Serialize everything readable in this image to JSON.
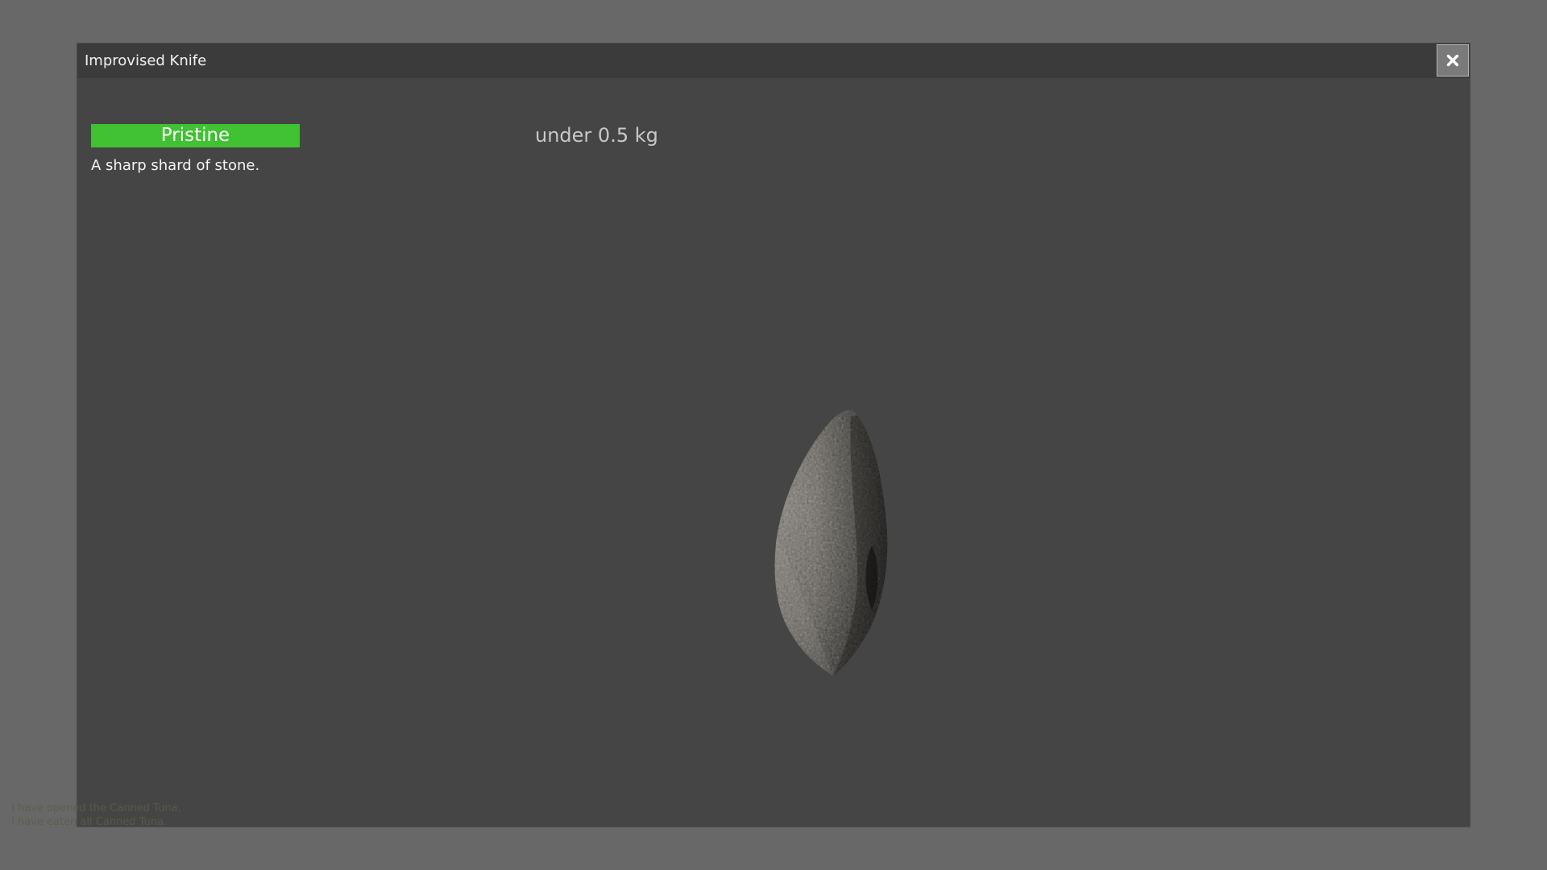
{
  "item_window": {
    "title": "Improvised Knife",
    "condition": "Pristine",
    "condition_color": "#40c232",
    "weight": "under 0.5 kg",
    "description": "A sharp shard of stone.",
    "close_icon": "close-icon"
  },
  "message_log": [
    "I have opened the Canned Tuna.",
    "I have eaten all Canned Tuna."
  ]
}
